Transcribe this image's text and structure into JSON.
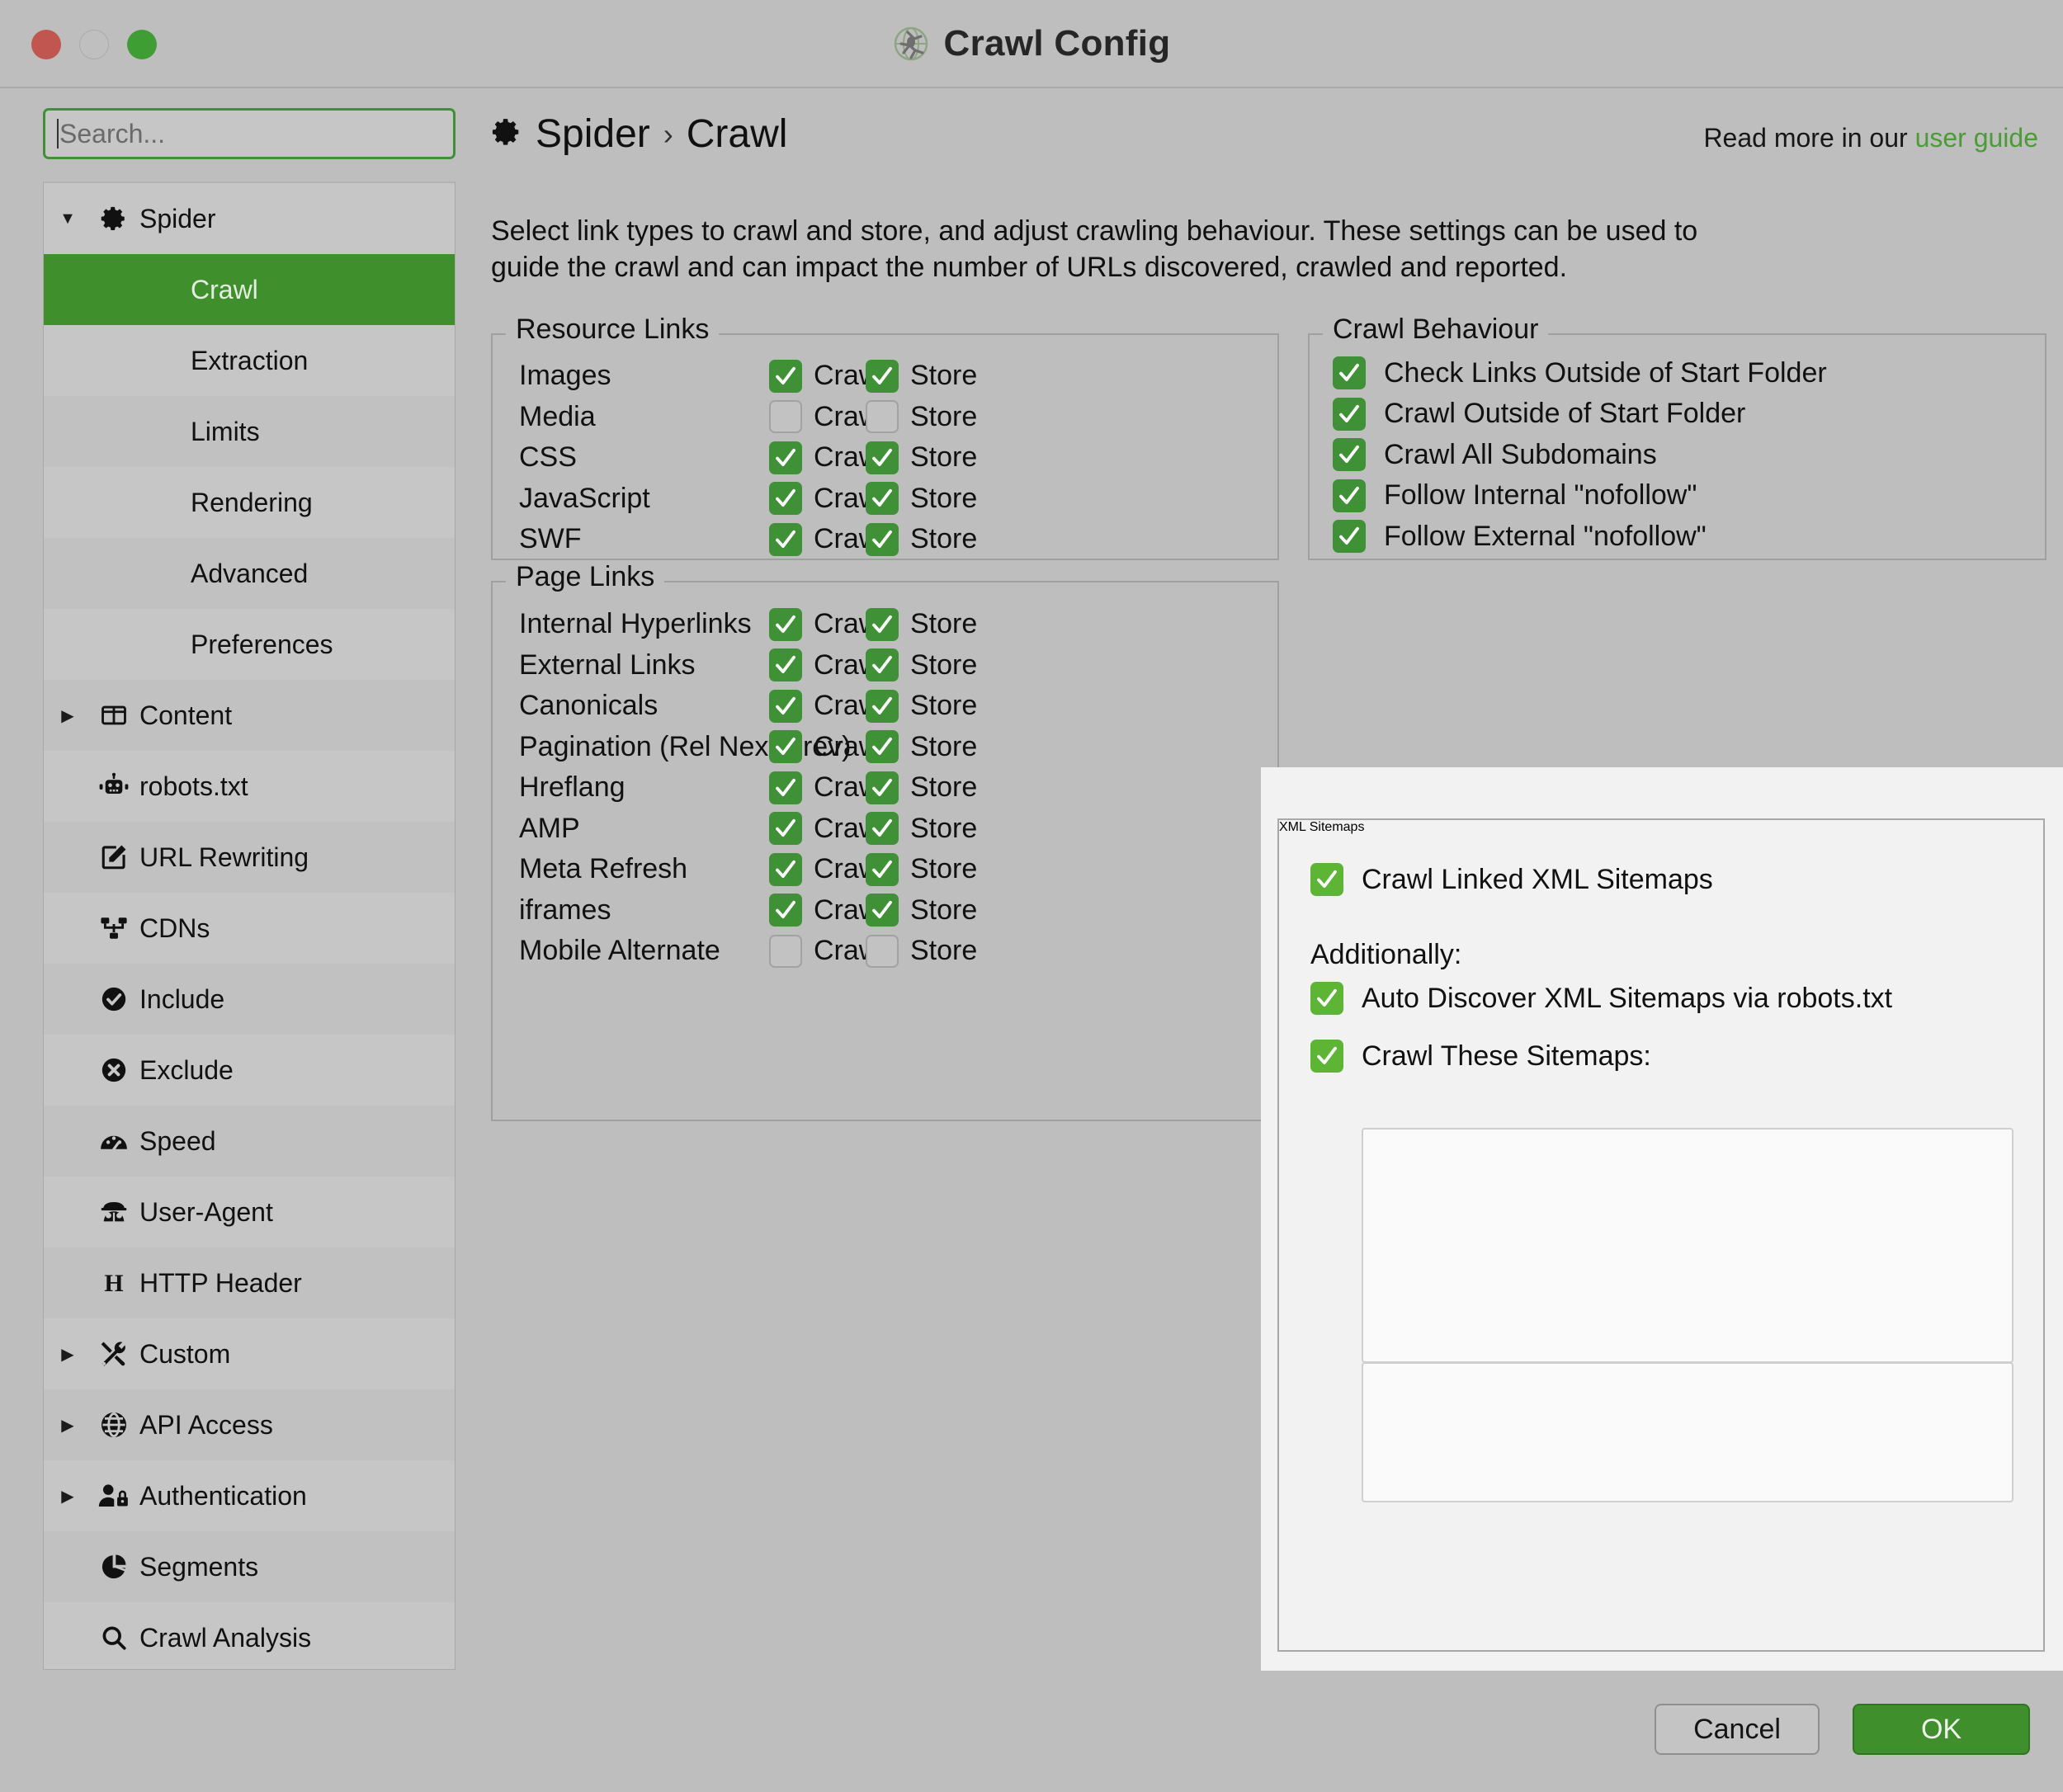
{
  "window": {
    "title": "Crawl Config",
    "app_icon": "spider-globe-icon",
    "traffic_lights": [
      "close-button",
      "minimize-button",
      "zoom-button"
    ]
  },
  "sidebar": {
    "search": {
      "placeholder": "Search...",
      "value": ""
    },
    "items": [
      {
        "label": "Spider",
        "icon": "gear-icon",
        "level": 1,
        "expanded": true,
        "twisty": "▼",
        "selected": false
      },
      {
        "label": "Crawl",
        "icon": null,
        "level": 2,
        "expanded": null,
        "twisty": "",
        "selected": true
      },
      {
        "label": "Extraction",
        "icon": null,
        "level": 2,
        "expanded": null,
        "twisty": "",
        "selected": false
      },
      {
        "label": "Limits",
        "icon": null,
        "level": 2,
        "expanded": null,
        "twisty": "",
        "selected": false
      },
      {
        "label": "Rendering",
        "icon": null,
        "level": 2,
        "expanded": null,
        "twisty": "",
        "selected": false
      },
      {
        "label": "Advanced",
        "icon": null,
        "level": 2,
        "expanded": null,
        "twisty": "",
        "selected": false
      },
      {
        "label": "Preferences",
        "icon": null,
        "level": 2,
        "expanded": null,
        "twisty": "",
        "selected": false
      },
      {
        "label": "Content",
        "icon": "columns-icon",
        "level": 1,
        "expanded": false,
        "twisty": "▶",
        "selected": false
      },
      {
        "label": "robots.txt",
        "icon": "robot-icon",
        "level": 1,
        "expanded": null,
        "twisty": "",
        "selected": false
      },
      {
        "label": "URL Rewriting",
        "icon": "edit-square-icon",
        "level": 1,
        "expanded": null,
        "twisty": "",
        "selected": false
      },
      {
        "label": "CDNs",
        "icon": "sitemap-icon",
        "level": 1,
        "expanded": null,
        "twisty": "",
        "selected": false
      },
      {
        "label": "Include",
        "icon": "check-circle-icon",
        "level": 1,
        "expanded": null,
        "twisty": "",
        "selected": false
      },
      {
        "label": "Exclude",
        "icon": "times-circle-icon",
        "level": 1,
        "expanded": null,
        "twisty": "",
        "selected": false
      },
      {
        "label": "Speed",
        "icon": "gauge-icon",
        "level": 1,
        "expanded": null,
        "twisty": "",
        "selected": false
      },
      {
        "label": "User-Agent",
        "icon": "spy-icon",
        "level": 1,
        "expanded": null,
        "twisty": "",
        "selected": false
      },
      {
        "label": "HTTP Header",
        "icon": "letter-h-icon",
        "level": 1,
        "expanded": null,
        "twisty": "",
        "selected": false
      },
      {
        "label": "Custom",
        "icon": "tools-icon",
        "level": 1,
        "expanded": false,
        "twisty": "▶",
        "selected": false
      },
      {
        "label": "API Access",
        "icon": "globe-icon",
        "level": 1,
        "expanded": false,
        "twisty": "▶",
        "selected": false
      },
      {
        "label": "Authentication",
        "icon": "user-lock-icon",
        "level": 1,
        "expanded": false,
        "twisty": "▶",
        "selected": false
      },
      {
        "label": "Segments",
        "icon": "pie-chart-icon",
        "level": 1,
        "expanded": null,
        "twisty": "",
        "selected": false
      },
      {
        "label": "Crawl Analysis",
        "icon": "search-icon",
        "level": 1,
        "expanded": null,
        "twisty": "",
        "selected": false
      }
    ]
  },
  "main": {
    "breadcrumb": {
      "icon": "gear-icon",
      "root": "Spider",
      "separator": "›",
      "current": "Crawl"
    },
    "read_more": {
      "prefix": "Read more in our",
      "link": "user guide"
    },
    "intro": "Select link types to crawl and store, and adjust crawling behaviour. These settings can be used to guide the crawl and can impact the number of URLs discovered, crawled and reported.",
    "crawl_label": "Crawl",
    "store_label": "Store",
    "resource_links": {
      "legend": "Resource Links",
      "rows": [
        {
          "label": "Images",
          "crawl": true,
          "store": true
        },
        {
          "label": "Media",
          "crawl": false,
          "store": false
        },
        {
          "label": "CSS",
          "crawl": true,
          "store": true
        },
        {
          "label": "JavaScript",
          "crawl": true,
          "store": true
        },
        {
          "label": "SWF",
          "crawl": true,
          "store": true
        }
      ]
    },
    "page_links": {
      "legend": "Page Links",
      "rows": [
        {
          "label": "Internal Hyperlinks",
          "crawl": true,
          "store": true
        },
        {
          "label": "External Links",
          "crawl": true,
          "store": true
        },
        {
          "label": "Canonicals",
          "crawl": true,
          "store": true
        },
        {
          "label": "Pagination (Rel Next/Prev)",
          "crawl": true,
          "store": true
        },
        {
          "label": "Hreflang",
          "crawl": true,
          "store": true
        },
        {
          "label": "AMP",
          "crawl": true,
          "store": true
        },
        {
          "label": "Meta Refresh",
          "crawl": true,
          "store": true
        },
        {
          "label": "iframes",
          "crawl": true,
          "store": true
        },
        {
          "label": "Mobile Alternate",
          "crawl": false,
          "store": false
        }
      ]
    },
    "crawl_behaviour": {
      "legend": "Crawl Behaviour",
      "rows": [
        {
          "label": "Check Links Outside of Start Folder",
          "checked": true
        },
        {
          "label": "Crawl Outside of Start Folder",
          "checked": true
        },
        {
          "label": "Crawl All Subdomains",
          "checked": true
        },
        {
          "label": "Follow Internal \"nofollow\"",
          "checked": true
        },
        {
          "label": "Follow External \"nofollow\"",
          "checked": true
        }
      ]
    },
    "xml_sitemaps": {
      "legend": "XML Sitemaps",
      "crawl_linked": {
        "label": "Crawl Linked XML Sitemaps",
        "checked": true
      },
      "additionally_label": "Additionally:",
      "auto_discover": {
        "label": "Auto Discover XML Sitemaps via robots.txt",
        "checked": true
      },
      "crawl_these": {
        "label": "Crawl These Sitemaps:",
        "checked": true
      },
      "sitemap_list": [],
      "sitemap_list_secondary": []
    }
  },
  "footer": {
    "cancel_label": "Cancel",
    "ok_label": "OK"
  },
  "colors": {
    "accent_green": "#3f8f2c",
    "checkbox_green": "#3f9136",
    "checkbox_green_bright": "#5cb533",
    "window_bg": "#bebebe",
    "panel_highlight": "#f2f2f2",
    "link_green": "#4a9c34"
  }
}
